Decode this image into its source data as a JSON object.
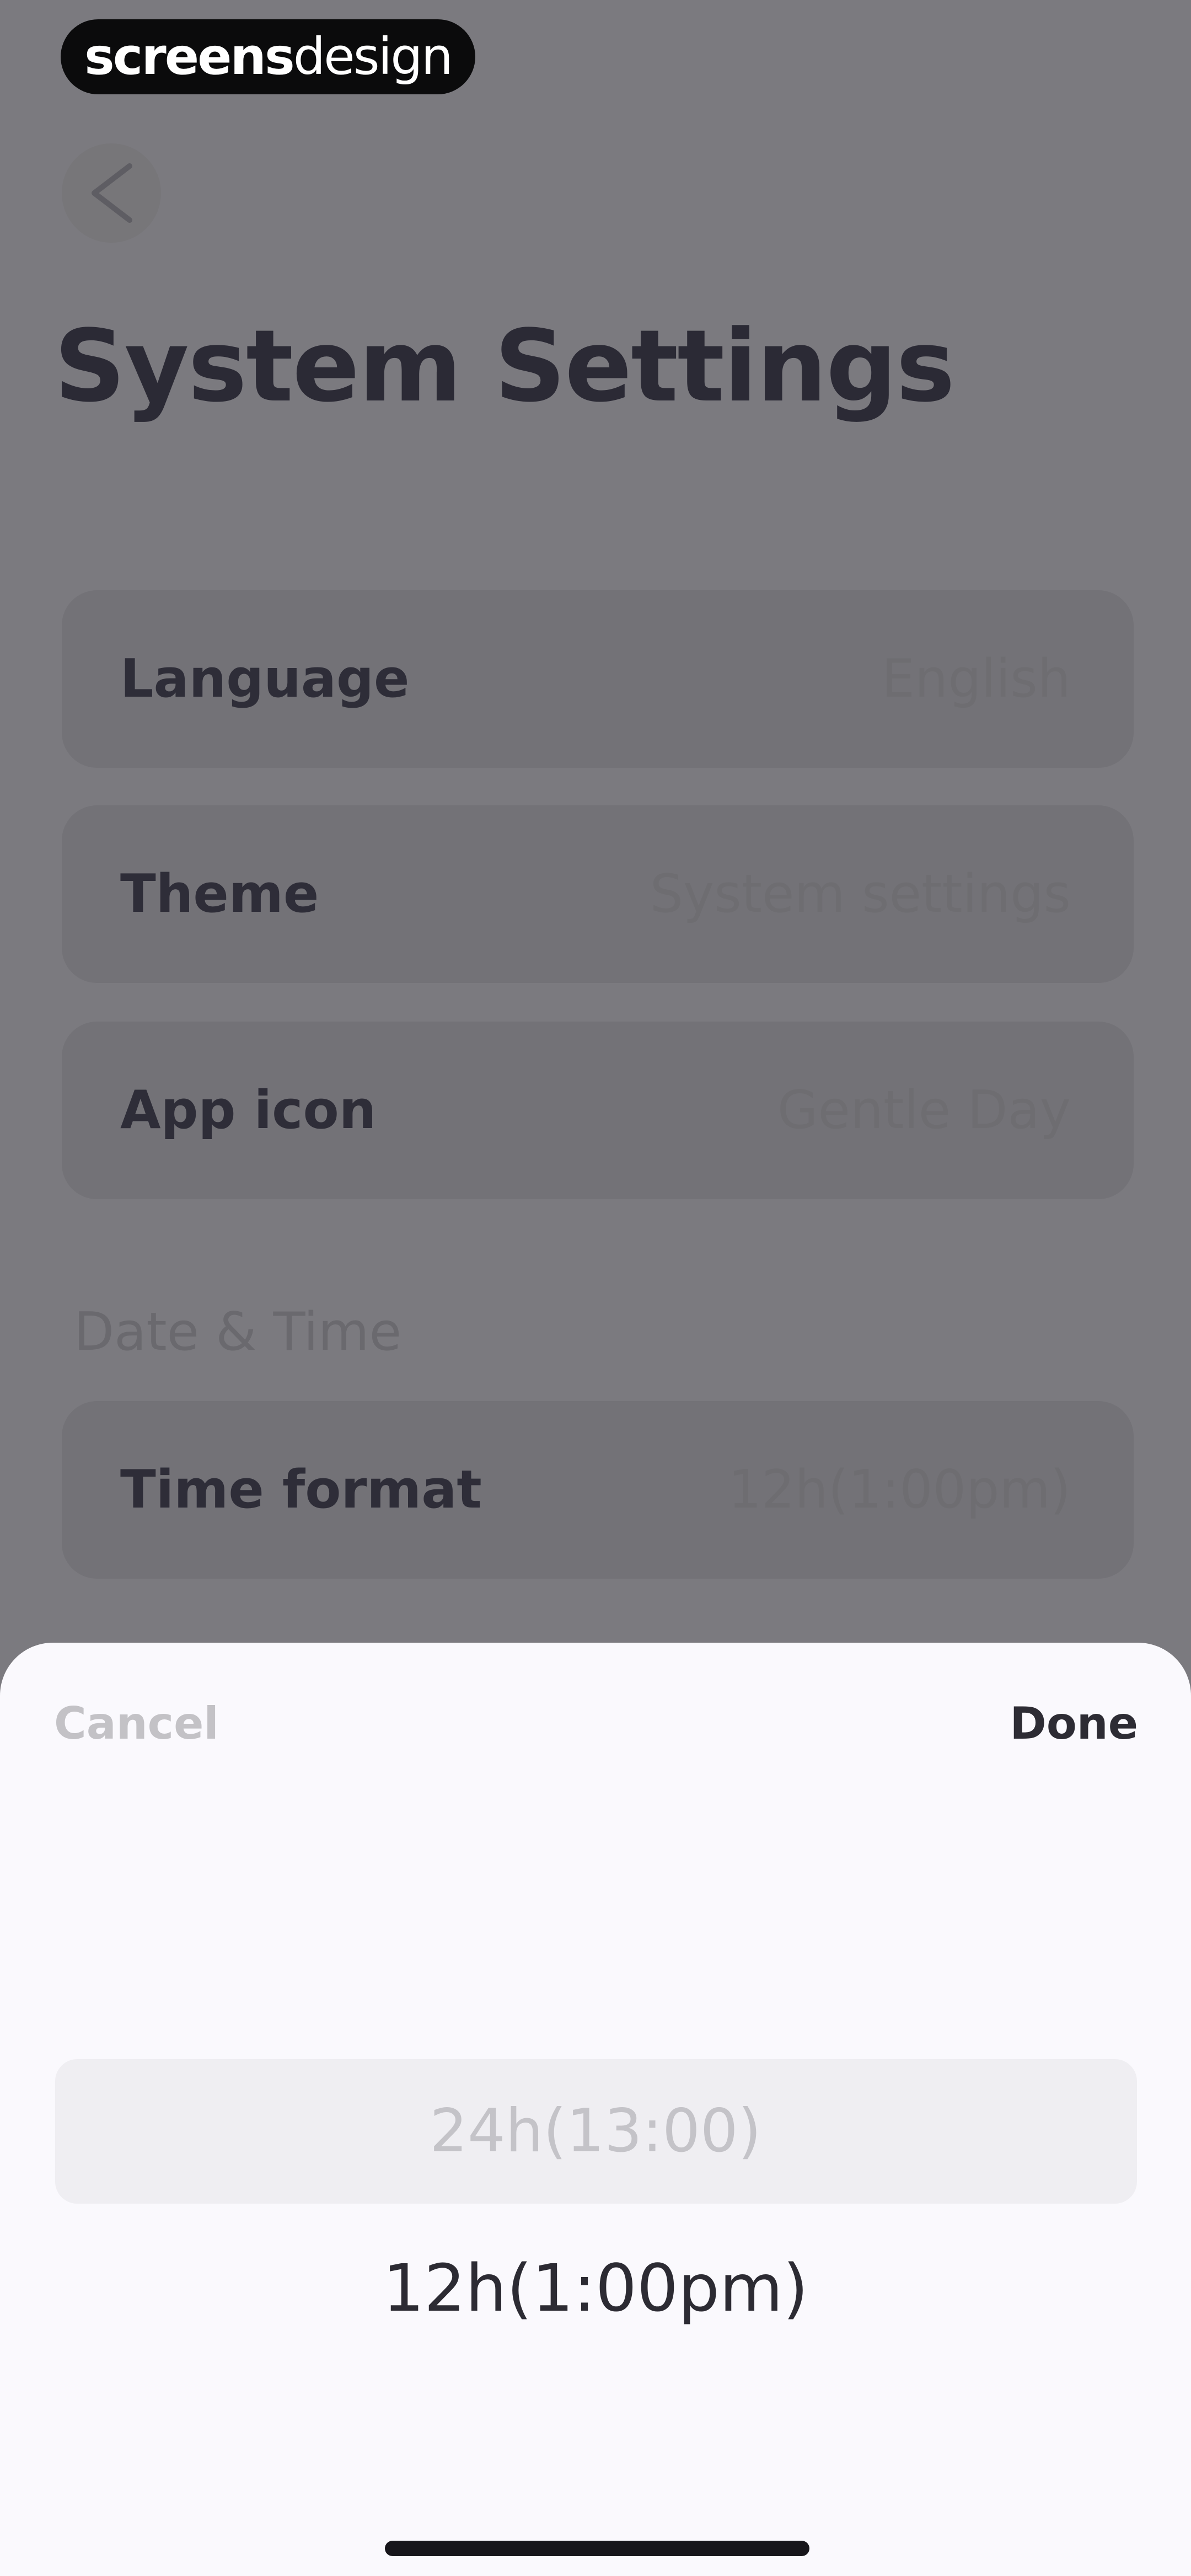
{
  "watermark": {
    "strong": "screens",
    "light": "design"
  },
  "header": {
    "back_icon": "chevron-left-icon",
    "title": "System Settings"
  },
  "settings": {
    "language": {
      "label": "Language",
      "value": "English"
    },
    "theme": {
      "label": "Theme",
      "value": "System settings"
    },
    "app_icon": {
      "label": "App icon",
      "value": "Gentle Day"
    }
  },
  "date_time": {
    "section_label": "Date & Time",
    "time_format": {
      "label": "Time format",
      "value": "12h(1:00pm)"
    }
  },
  "picker": {
    "cancel_label": "Cancel",
    "done_label": "Done",
    "options": [
      "24h(13:00)",
      "12h(1:00pm)"
    ]
  },
  "colors": {
    "overlay_background": "#7b7a7f",
    "sheet_background": "#faf9fd",
    "title_text": "#2b2a35"
  }
}
